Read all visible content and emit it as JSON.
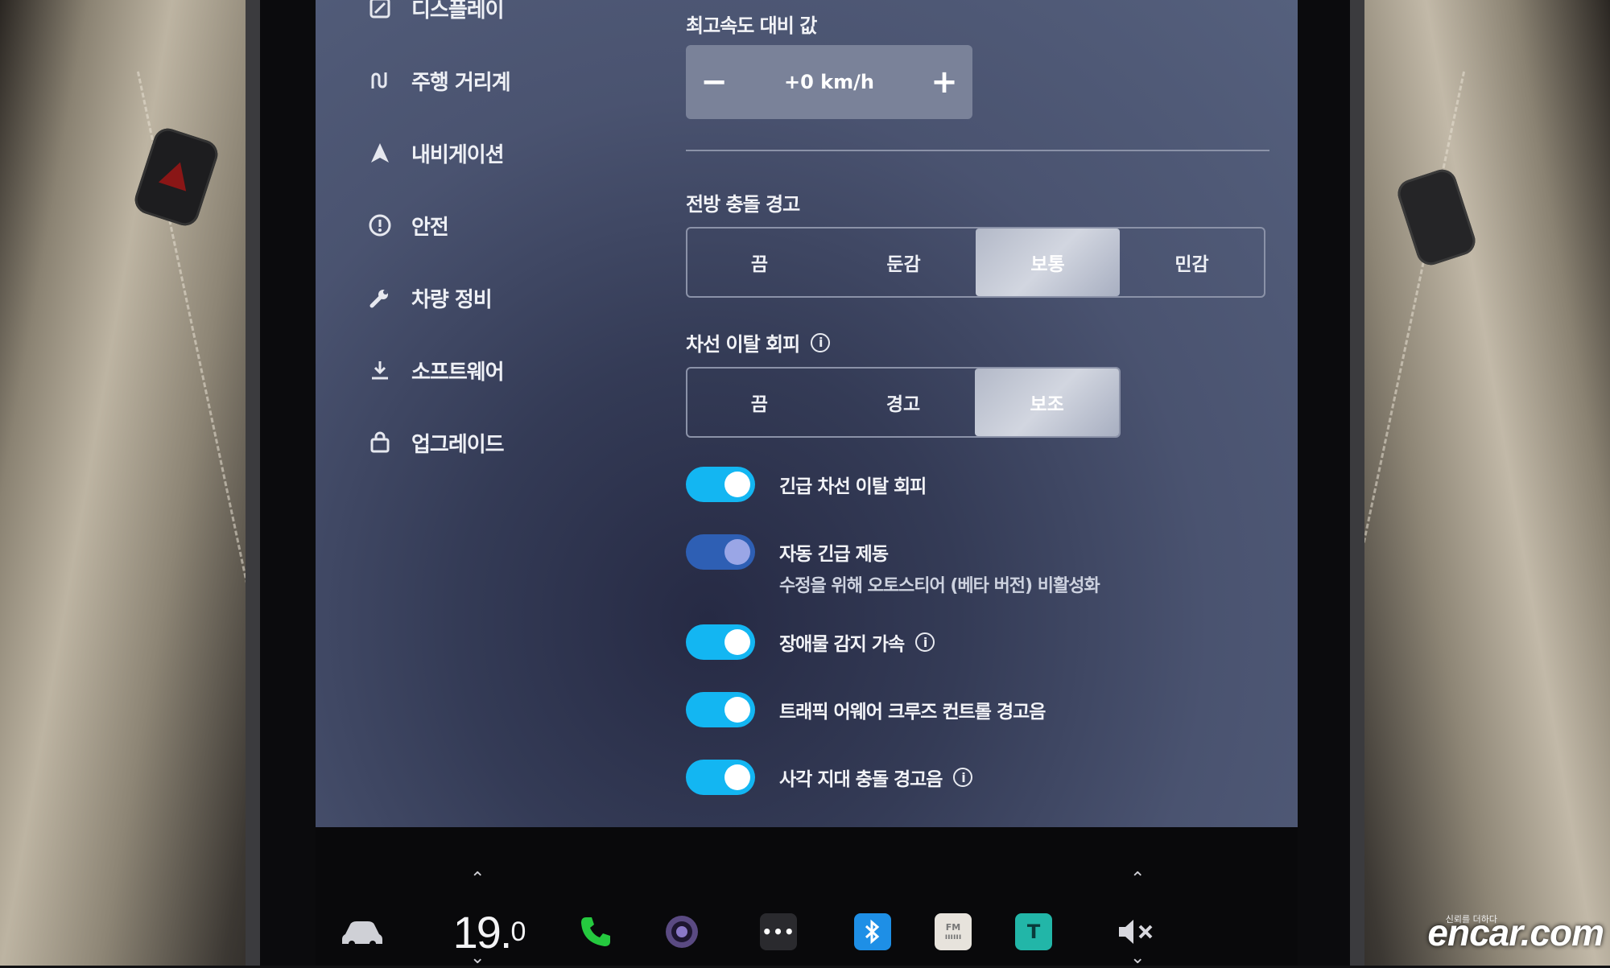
{
  "sidebar": {
    "items": [
      {
        "label": "디스플레이",
        "icon": "display-icon"
      },
      {
        "label": "주행 거리계",
        "icon": "trip-icon"
      },
      {
        "label": "내비게이션",
        "icon": "navigation-icon"
      },
      {
        "label": "안전",
        "icon": "safety-icon"
      },
      {
        "label": "차량 정비",
        "icon": "wrench-icon"
      },
      {
        "label": "소프트웨어",
        "icon": "download-icon"
      },
      {
        "label": "업그레이드",
        "icon": "shopping-bag-icon"
      }
    ]
  },
  "speed_offset": {
    "label": "최고속도 대비 값",
    "value": "+0 km/h",
    "minus": "−",
    "plus": "+"
  },
  "forward_collision": {
    "label": "전방 충돌 경고",
    "options": [
      "끔",
      "둔감",
      "보통",
      "민감"
    ],
    "selected": "보통"
  },
  "lane_departure": {
    "label": "차선 이탈 회피",
    "info": "i",
    "options": [
      "끔",
      "경고",
      "보조"
    ],
    "selected": "보조"
  },
  "toggles": [
    {
      "label": "긴급 차선 이탈 회피",
      "on": true,
      "info": false,
      "sub": ""
    },
    {
      "label": "자동 긴급 제동",
      "on": true,
      "dimmed": true,
      "info": false,
      "sub": "수정을 위해 오토스티어 (베타 버전) 비활성화"
    },
    {
      "label": "장애물 감지 가속",
      "on": true,
      "info": true,
      "sub": ""
    },
    {
      "label": "트래픽 어웨어 크루즈 컨트롤 경고음",
      "on": true,
      "info": false,
      "sub": ""
    },
    {
      "label": "사각 지대 충돌 경고음",
      "on": true,
      "info": true,
      "sub": ""
    }
  ],
  "taskbar": {
    "temperature": "19.",
    "temperature_decimal": "0",
    "icons": [
      "car-icon",
      "phone-icon",
      "camera-icon",
      "more-icon",
      "bluetooth-icon",
      "radio-icon",
      "app-icon",
      "mute-icon"
    ],
    "radio_label": "FM"
  },
  "watermark": {
    "brand": "encar.com",
    "tagline": "신뢰를 더하다"
  },
  "colors": {
    "toggle_on": "#13b6f2",
    "toggle_dim": "#2e5fb4",
    "phone": "#25c93f",
    "bluetooth": "#1e8fe6",
    "app_tile": "#22b6a8"
  }
}
